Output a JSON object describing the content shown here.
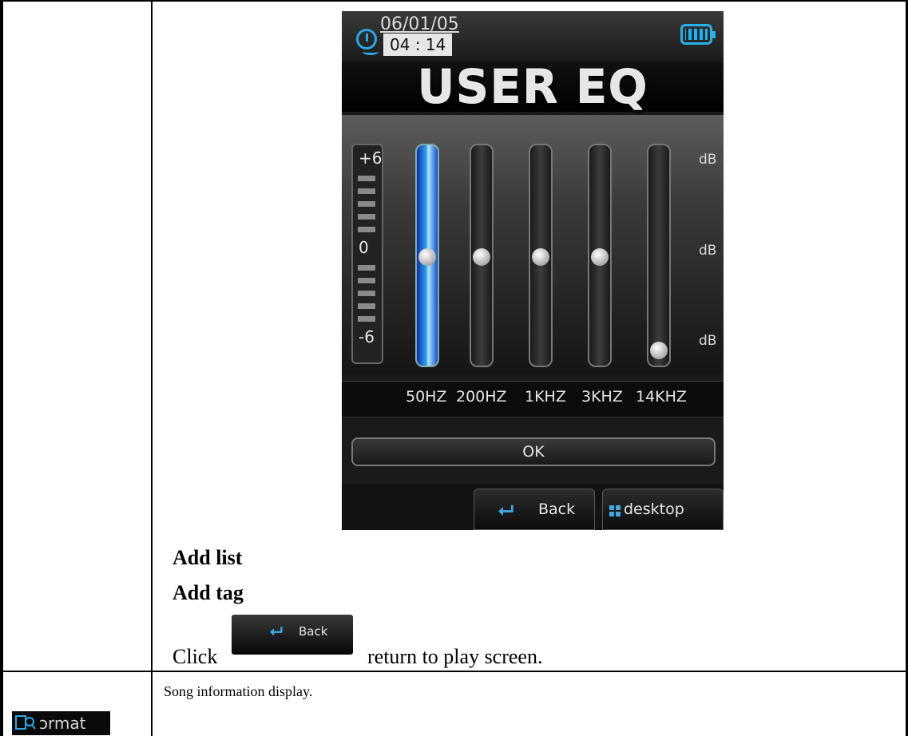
{
  "device": {
    "status": {
      "date": "06/01/05",
      "time": "04 : 14",
      "clock_icon": "clock-icon",
      "battery_icon": "battery-icon"
    },
    "title": "USER EQ",
    "scale": {
      "top": "+6",
      "mid": "0",
      "bottom": "-6"
    },
    "db_labels": [
      "dB",
      "dB",
      "dB"
    ],
    "bands": [
      {
        "label": "50HZ",
        "level_db": 0,
        "active": true
      },
      {
        "label": "200HZ",
        "level_db": 0,
        "active": false
      },
      {
        "label": "1KHZ",
        "level_db": 0,
        "active": false
      },
      {
        "label": "3KHZ",
        "level_db": 0,
        "active": false
      },
      {
        "label": "14KHZ",
        "level_db": -6,
        "active": false
      }
    ],
    "ok_label": "OK",
    "back_label": "Back",
    "desktop_label": "desktop",
    "accent": "#2aa6e6"
  },
  "doc": {
    "add_list": "Add list",
    "add_tag": "Add tag",
    "click_prefix": "Click",
    "click_suffix": "return to play screen.",
    "inline_back_label": "Back",
    "format_icon_text": "ɔrmat",
    "song_info": "Song information display."
  }
}
